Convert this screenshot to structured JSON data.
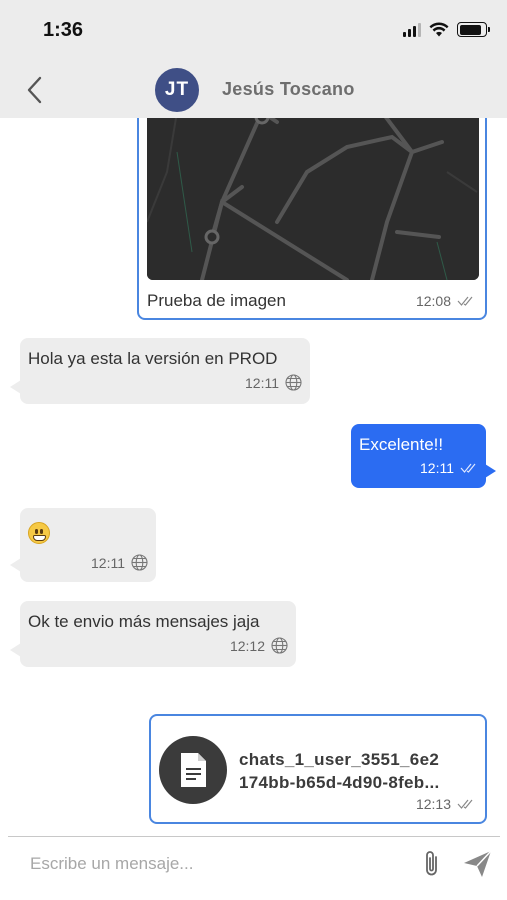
{
  "status_bar": {
    "time": "1:36",
    "battery_level": 0.85
  },
  "header": {
    "back_icon": "chevron-left-icon",
    "avatar_initials": "JT",
    "avatar_color": "#3f4f86",
    "contact_name": "Jesús Toscano"
  },
  "messages": [
    {
      "direction": "outgoing",
      "kind": "image",
      "caption": "Prueba de imagen",
      "time": "12:08",
      "status_icon": "double-check-icon"
    },
    {
      "direction": "incoming",
      "kind": "text",
      "text": "Hola ya esta la versión en PROD",
      "time": "12:11",
      "status_icon": "globe-icon"
    },
    {
      "direction": "outgoing",
      "kind": "text",
      "text": "Excelente!!",
      "time": "12:11",
      "status_icon": "double-check-icon",
      "color": "#2b6cf2"
    },
    {
      "direction": "incoming",
      "kind": "emoji",
      "text": "grimacing-face",
      "time": "12:11",
      "status_icon": "globe-icon"
    },
    {
      "direction": "incoming",
      "kind": "text",
      "text": "Ok te envio más mensajes jaja",
      "time": "12:12",
      "status_icon": "globe-icon"
    },
    {
      "direction": "outgoing",
      "kind": "file",
      "file_name_line1": "chats_1_user_3551_6e2",
      "file_name_line2": "174bb-b65d-4d90-8feb...",
      "time": "12:13",
      "status_icon": "double-check-icon",
      "file_icon": "document-icon"
    }
  ],
  "composer": {
    "placeholder": "Escribe un mensaje...",
    "value": "",
    "attach_icon": "paperclip-icon",
    "send_icon": "send-icon"
  },
  "colors": {
    "header_bg": "#ececec",
    "incoming_bg": "#ededed",
    "outgoing_border": "#4a86e0",
    "outgoing_fill": "#2b6cf2"
  }
}
